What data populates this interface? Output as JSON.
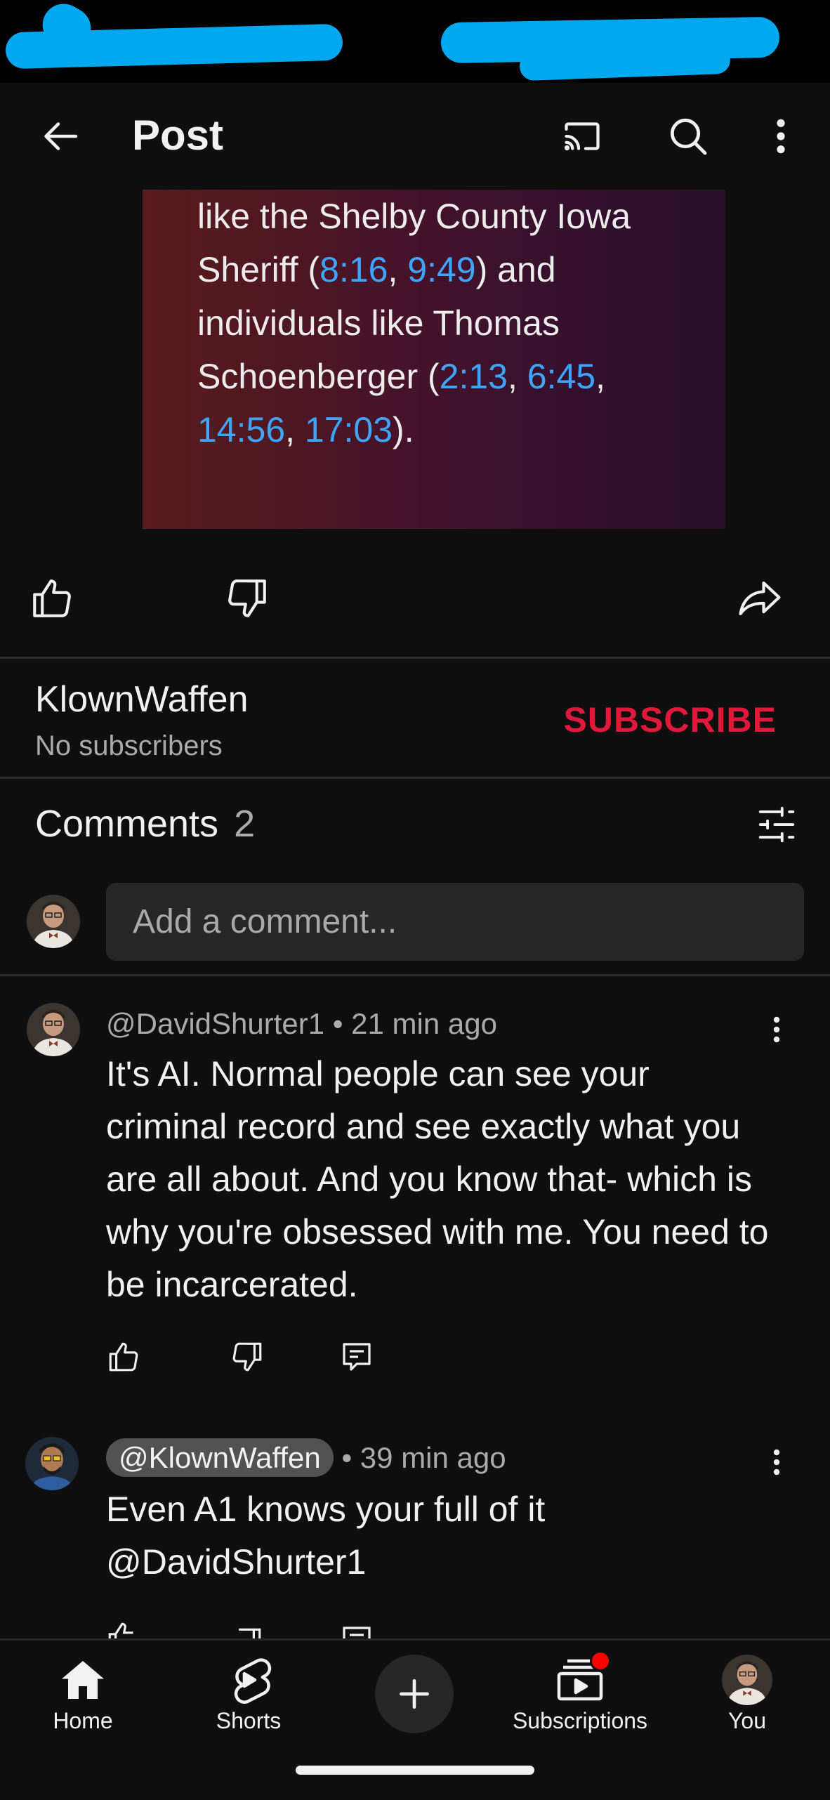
{
  "header": {
    "title": "Post",
    "icons": [
      "back-arrow-icon",
      "cast-icon",
      "search-icon",
      "more-vert-icon"
    ]
  },
  "post": {
    "text_plain_1": "like the Shelby County Iowa",
    "text_plain_2": "Sheriff (",
    "ts_1": "8:16",
    "sep_1": ", ",
    "ts_2": "9:49",
    "text_plain_3": ") and",
    "text_plain_4": "individuals like Thomas",
    "text_plain_5": "Schoenberger (",
    "ts_3": "2:13",
    "sep_2": ", ",
    "ts_4": "6:45",
    "sep_3": ",",
    "ts_5": "14:56",
    "sep_4": ", ",
    "ts_6": "17:03",
    "text_plain_6": ")."
  },
  "actions": {
    "icons": [
      "like-icon",
      "dislike-icon",
      "share-icon"
    ]
  },
  "channel": {
    "name": "KlownWaffen",
    "subscribers": "No subscribers",
    "subscribe_label": "SUBSCRIBE",
    "subscribe_color": "#e0193b"
  },
  "comments": {
    "header_label": "Comments",
    "count": "2",
    "add_placeholder": "Add a comment...",
    "items": [
      {
        "author": "@DavidShurter1",
        "time": "• 21 min ago",
        "body": "It's AI. Normal people can see your criminal record and see exactly what you are all about. And you know that- which is why you're obsessed with me. You need to be incarcerated."
      },
      {
        "author": "@KlownWaffen",
        "time": "• 39 min ago",
        "body": "Even A1 knows your full of it @DavidShurter1"
      }
    ]
  },
  "nav": {
    "home": "Home",
    "shorts": "Shorts",
    "subscriptions": "Subscriptions",
    "you": "You",
    "notification_dot_color": "#ff0000"
  },
  "colors": {
    "background": "#0f0f0f",
    "timestamp_link": "#3ea6ff",
    "secondary_text": "#aaaaaa",
    "status_scribble": "#00a8f0"
  }
}
